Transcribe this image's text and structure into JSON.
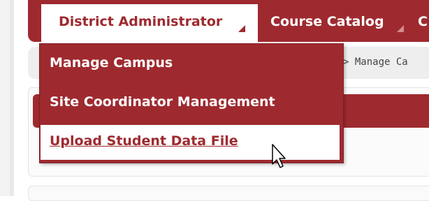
{
  "nav": {
    "tabs": [
      {
        "label": "District Administrator"
      },
      {
        "label": "Course Catalog"
      },
      {
        "label": "C"
      }
    ]
  },
  "breadcrumb": {
    "text": "> Manage Ca"
  },
  "dropdown": {
    "items": [
      {
        "label": "Manage Campus"
      },
      {
        "label": "Site Coordinator Management"
      },
      {
        "label": "Upload Student Data File"
      }
    ]
  },
  "colors": {
    "brand": "#9e2a2f",
    "background": "#ffffff",
    "breadcrumb_bg": "#eeeeee"
  },
  "icons": {
    "cursor": "pointer-arrow-icon",
    "caret": "caret-down-icon"
  }
}
